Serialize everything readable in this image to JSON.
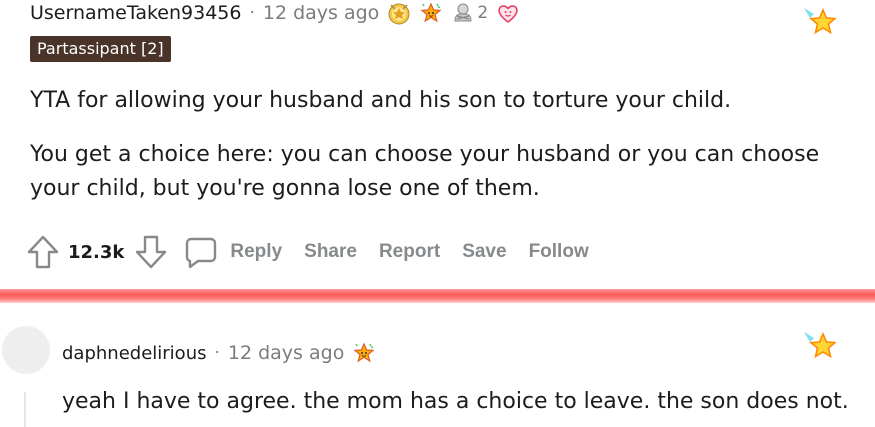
{
  "comments": [
    {
      "author": "UsernameTaken93456",
      "separator": "·",
      "time": "12 days ago",
      "awards": [
        {
          "icon": "helpful-award-icon"
        },
        {
          "icon": "wholesome-award-icon"
        },
        {
          "icon": "hugz-award-icon",
          "count": "2"
        },
        {
          "icon": "heart-award-icon"
        }
      ],
      "flair": "Partassipant [2]",
      "paragraphs": [
        "YTA for allowing your husband and his son to torture your child.",
        "You get a choice here: you can choose your husband or you can choose your child, but you're gonna lose one of them."
      ],
      "votes": "12.3k",
      "actions": [
        "Reply",
        "Share",
        "Report",
        "Save",
        "Follow"
      ]
    },
    {
      "author": "daphnedelirious",
      "separator": "·",
      "time": "12 days ago",
      "awards": [
        {
          "icon": "wholesome-award-icon"
        }
      ],
      "text": "yeah I have to agree. the mom has a choice to leave. the son does not."
    }
  ],
  "colors": {
    "meta_gray": "#7c7c7c",
    "action_gray": "#878a8c",
    "flair_bg": "#4a3328",
    "divider": "#ff6b6b"
  }
}
